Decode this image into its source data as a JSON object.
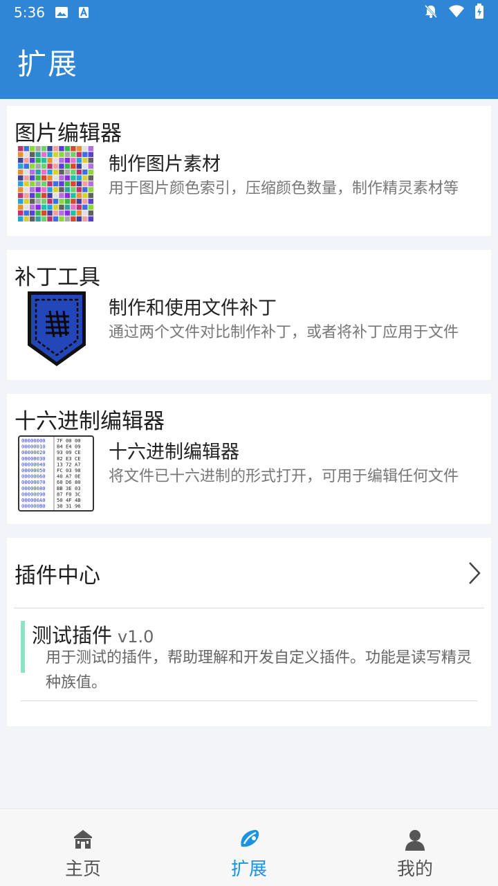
{
  "status_bar": {
    "time": "5:36"
  },
  "app_bar": {
    "title": "扩展"
  },
  "cards": [
    {
      "title": "图片编辑器",
      "item_title": "制作图片素材",
      "item_desc": "用于图片颜色索引，压缩颜色数量，制作精灵素材等"
    },
    {
      "title": "补丁工具",
      "item_title": "制作和使用文件补丁",
      "item_desc": "通过两个文件对比制作补丁，或者将补丁应用于文件"
    },
    {
      "title": "十六进制编辑器",
      "item_title": "十六进制编辑器",
      "item_desc": "将文件已十六进制的形式打开，可用于编辑任何文件"
    }
  ],
  "hex_thumb": {
    "rows": [
      [
        "00000000",
        "7F 00 00"
      ],
      [
        "00000010",
        "84 E4 09"
      ],
      [
        "00000020",
        "93 09 CE"
      ],
      [
        "00000030",
        "82 E3 CE"
      ],
      [
        "00000040",
        "13 72 A7"
      ],
      [
        "00000050",
        "FC 03 98"
      ],
      [
        "00000060",
        "40 A7 0E"
      ],
      [
        "00000070",
        "60 D6 80"
      ],
      [
        "00000080",
        "BB 3E 03"
      ],
      [
        "00000090",
        "87 F0 3C"
      ],
      [
        "000000A0",
        "50 4F 4B"
      ],
      [
        "000000B0",
        "30 31 96"
      ]
    ]
  },
  "plugin_center": {
    "label": "插件中心",
    "plugin": {
      "name": "测试插件",
      "version": "v1.0",
      "desc": "用于测试的插件，帮助理解和开发自定义插件。功能是读写精灵种族值。"
    }
  },
  "bottom_nav": [
    {
      "label": "主页",
      "icon": "home-icon"
    },
    {
      "label": "扩展",
      "icon": "extension-icon",
      "active": true
    },
    {
      "label": "我的",
      "icon": "person-icon"
    }
  ],
  "colors": {
    "primary": "#2f86d6",
    "accent": "#1a93e0",
    "plugin_bar": "#8ee3c6"
  }
}
